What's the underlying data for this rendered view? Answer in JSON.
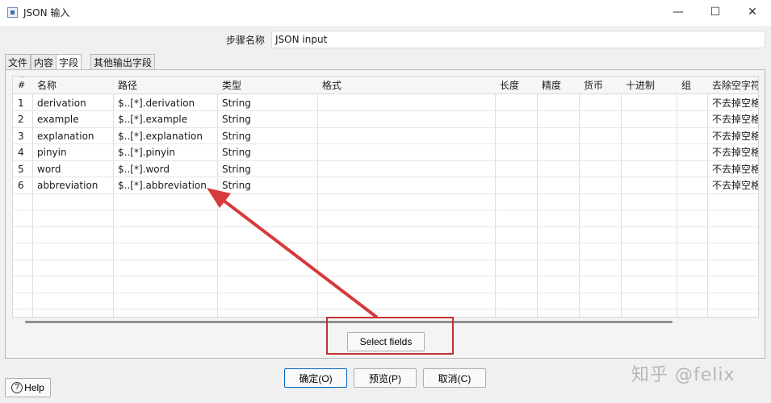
{
  "window": {
    "title": "JSON 输入",
    "min": "—",
    "max": "☐",
    "close": "✕"
  },
  "step": {
    "label": "步骤名称",
    "value": "JSON input"
  },
  "tabs": [
    {
      "label": "文件"
    },
    {
      "label": "内容"
    },
    {
      "label": "字段"
    },
    {
      "label": "其他输出字段"
    }
  ],
  "table": {
    "columns": [
      "#",
      "名称",
      "路径",
      "类型",
      "格式",
      "长度",
      "精度",
      "货币",
      "十进制",
      "组",
      "去除空字符串"
    ],
    "rows": [
      {
        "n": "1",
        "name": "derivation",
        "path": "$..[*].derivation",
        "type": "String",
        "trim": "不去掉空格"
      },
      {
        "n": "2",
        "name": "example",
        "path": "$..[*].example",
        "type": "String",
        "trim": "不去掉空格"
      },
      {
        "n": "3",
        "name": "explanation",
        "path": "$..[*].explanation",
        "type": "String",
        "trim": "不去掉空格"
      },
      {
        "n": "4",
        "name": "pinyin",
        "path": "$..[*].pinyin",
        "type": "String",
        "trim": "不去掉空格"
      },
      {
        "n": "5",
        "name": "word",
        "path": "$..[*].word",
        "type": "String",
        "trim": "不去掉空格"
      },
      {
        "n": "6",
        "name": "abbreviation",
        "path": "$..[*].abbreviation",
        "type": "String",
        "trim": "不去掉空格"
      }
    ]
  },
  "select_fields_label": "Select fields",
  "footer": {
    "help": "Help",
    "ok": "确定(O)",
    "preview": "预览(P)",
    "cancel": "取消(C)"
  },
  "watermark": "知乎 @felix",
  "annotation_color": "#c53030"
}
